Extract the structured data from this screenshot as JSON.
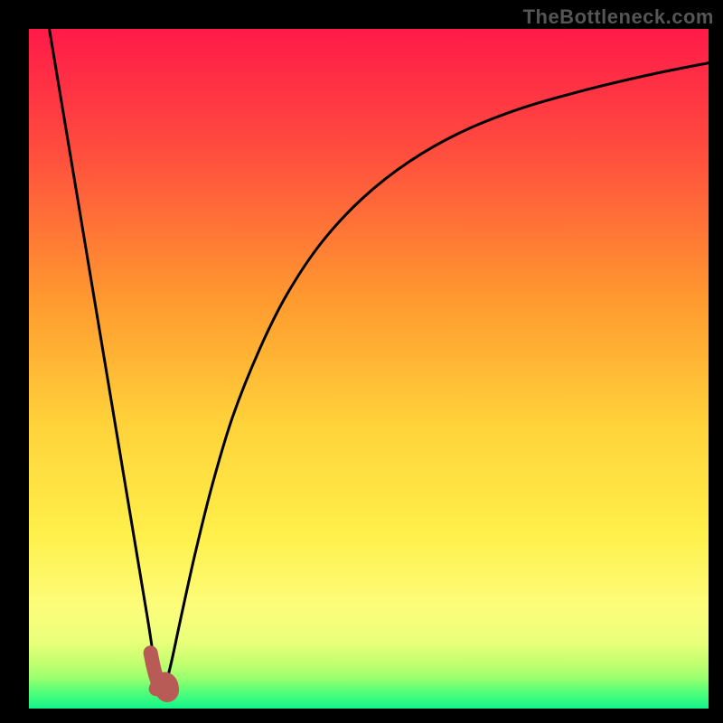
{
  "watermark": "TheBottleneck.com",
  "colors": {
    "frame": "#000000",
    "curve": "#000000",
    "marker": "#b85a55",
    "gradient_stops": [
      {
        "pct": 0,
        "hex": "#ff1a49"
      },
      {
        "pct": 18,
        "hex": "#ff4d3e"
      },
      {
        "pct": 40,
        "hex": "#ff9a2f"
      },
      {
        "pct": 58,
        "hex": "#ffd23a"
      },
      {
        "pct": 74,
        "hex": "#ffef4a"
      },
      {
        "pct": 85,
        "hex": "#fdfd7a"
      },
      {
        "pct": 90,
        "hex": "#eaff7a"
      },
      {
        "pct": 93,
        "hex": "#c7ff70"
      },
      {
        "pct": 95.5,
        "hex": "#9bff6e"
      },
      {
        "pct": 97.5,
        "hex": "#55ff78"
      },
      {
        "pct": 100,
        "hex": "#12f58b"
      }
    ]
  },
  "chart_data": {
    "type": "line",
    "title": "",
    "xlabel": "",
    "ylabel": "",
    "xlim": [
      0,
      100
    ],
    "ylim": [
      0,
      100
    ],
    "grid": false,
    "legend": false,
    "series": [
      {
        "name": "left-branch",
        "x": [
          3.0,
          5.0,
          8.0,
          11.0,
          14.0,
          16.0,
          17.5,
          18.2,
          18.8
        ],
        "values": [
          100,
          88.0,
          70.0,
          52.0,
          34.0,
          22.0,
          13.0,
          8.5,
          5.2
        ]
      },
      {
        "name": "right-branch",
        "x": [
          20.0,
          21.0,
          22.5,
          24.5,
          27.0,
          30.0,
          34.0,
          38.0,
          43.0,
          49.0,
          56.0,
          64.0,
          73.0,
          83.0,
          92.0,
          100.0
        ],
        "values": [
          3.0,
          7.0,
          14.0,
          23.0,
          33.0,
          43.0,
          53.0,
          61.0,
          68.5,
          75.0,
          80.5,
          85.0,
          88.5,
          91.3,
          93.4,
          95.0
        ]
      },
      {
        "name": "marker-J",
        "x": [
          17.9,
          18.4,
          18.9,
          19.4,
          19.9,
          20.4,
          20.9,
          21.0,
          20.7,
          20.0,
          19.2,
          18.7
        ],
        "values": [
          8.2,
          5.8,
          4.1,
          2.9,
          2.2,
          2.0,
          2.3,
          3.0,
          3.9,
          4.3,
          3.9,
          2.9
        ]
      }
    ]
  }
}
